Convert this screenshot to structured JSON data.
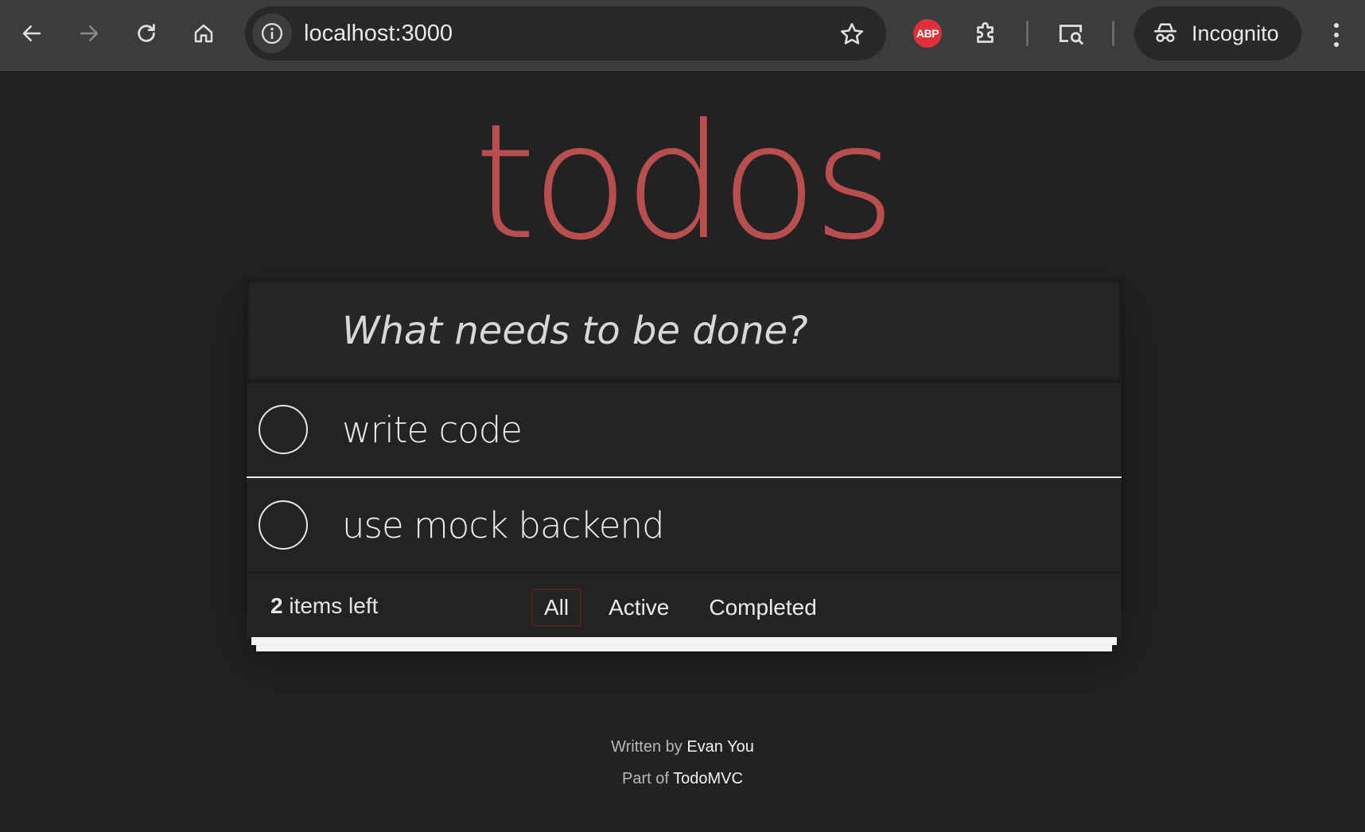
{
  "browser": {
    "url": "localhost:3000",
    "profile_label": "Incognito",
    "extension_badge": "ABP",
    "icons": [
      "back-icon",
      "forward-icon",
      "reload-icon",
      "home-icon",
      "info-icon",
      "star-icon",
      "abp-icon",
      "extensions-icon",
      "media-search-icon",
      "incognito-icon",
      "menu-icon"
    ],
    "colors": {
      "toolbar": "#3c3c3c",
      "omnibox": "#282828",
      "abp": "#e0313b"
    }
  },
  "app": {
    "title": "todos",
    "new_todo_placeholder": "What needs to be done?",
    "todos": [
      {
        "text": "write code",
        "completed": false
      },
      {
        "text": "use mock backend",
        "completed": false
      }
    ],
    "footer": {
      "count": "2",
      "count_suffix": " items left",
      "filters": [
        "All",
        "Active",
        "Completed"
      ],
      "selected_filter": "All"
    },
    "colors": {
      "title": "#b84e4e",
      "background": "#222222"
    }
  },
  "info": {
    "written_prefix": "Written by ",
    "author": "Evan You",
    "part_prefix": "Part of ",
    "project": "TodoMVC"
  }
}
